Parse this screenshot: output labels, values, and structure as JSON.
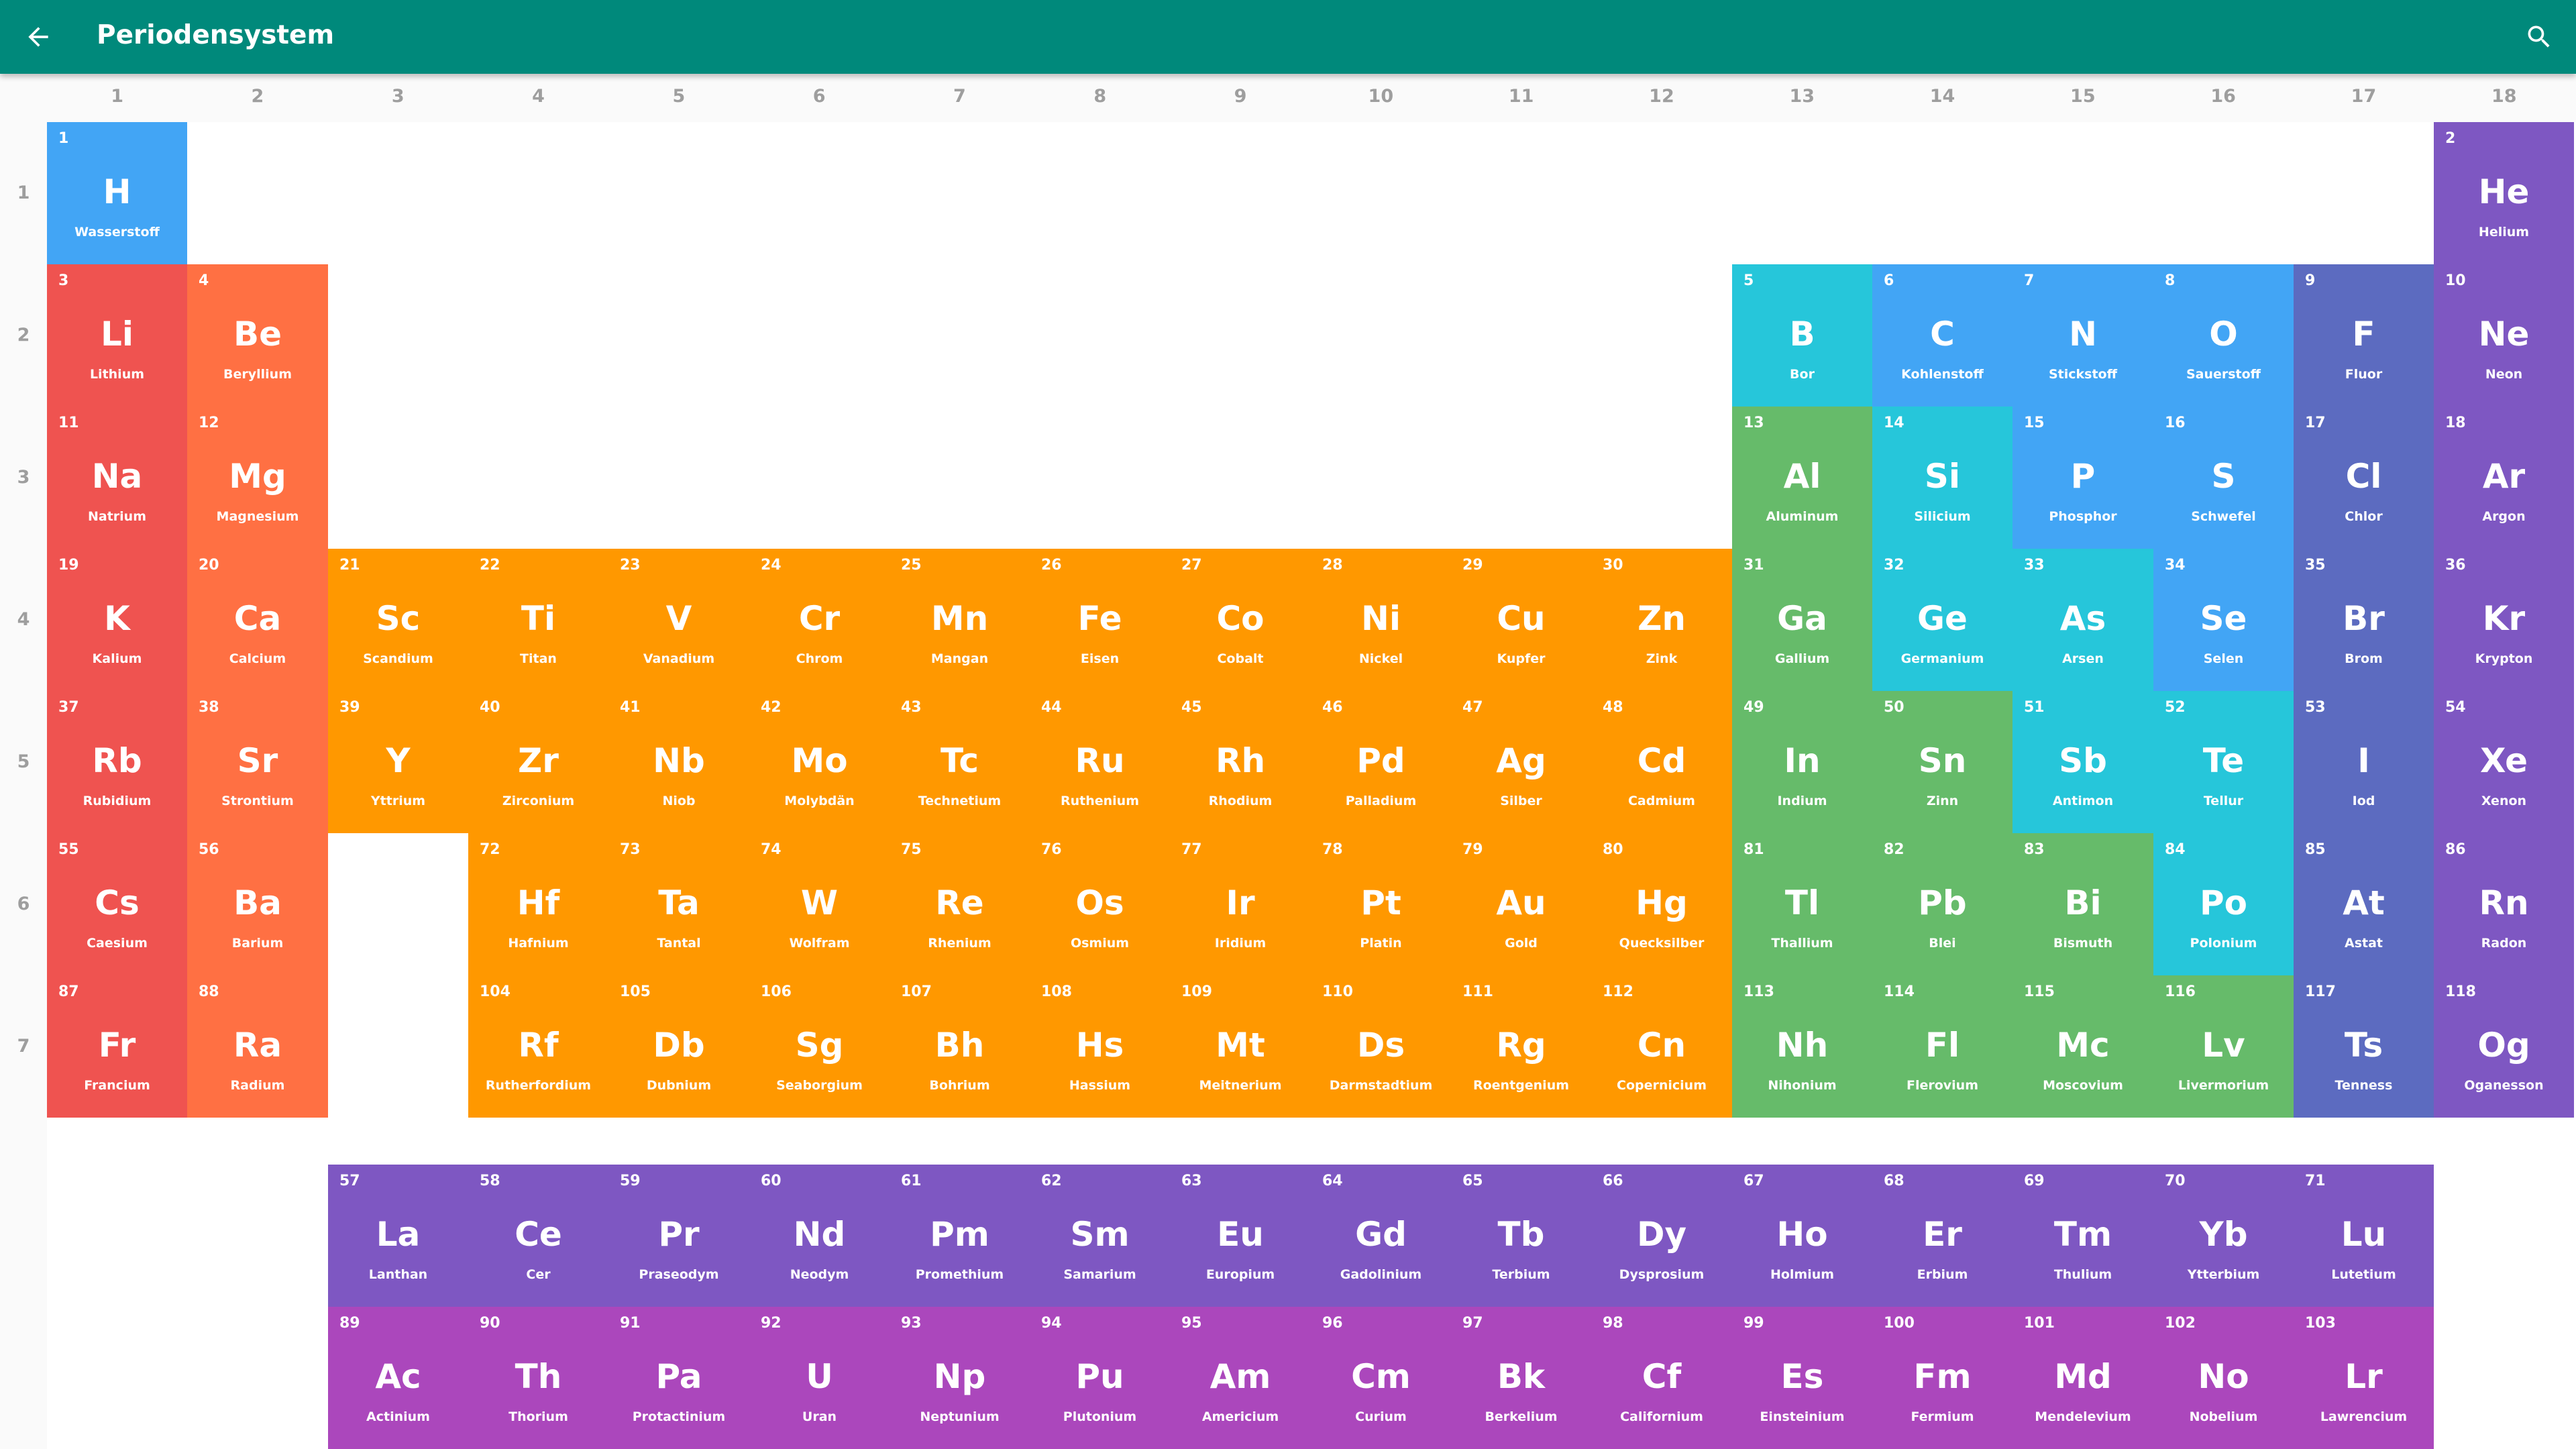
{
  "app_bar": {
    "title": "Periodensystem",
    "background": "#00897b",
    "back_icon": "arrow-back-icon",
    "search_icon": "search-icon"
  },
  "group_numbers": [
    "1",
    "2",
    "3",
    "4",
    "5",
    "6",
    "7",
    "8",
    "9",
    "10",
    "11",
    "12",
    "13",
    "14",
    "15",
    "16",
    "17",
    "18"
  ],
  "period_numbers": [
    "1",
    "2",
    "3",
    "4",
    "5",
    "6",
    "7"
  ],
  "category_colors": {
    "alkali": "#ef5350",
    "alkaline": "#ff7043",
    "transition": "#ff9800",
    "post_transition": "#66bb6a",
    "metalloid": "#26c6da",
    "nonmetal": "#42a5f5",
    "halogen": "#5c6bc0",
    "noble": "#7e57c2",
    "lanthanide": "#7e57c2",
    "actinide": "#ab47bc"
  },
  "elements": [
    {
      "n": "1",
      "s": "H",
      "name": "Wasserstoff",
      "c": "nonmetal",
      "row": 1,
      "col": 1
    },
    {
      "n": "2",
      "s": "He",
      "name": "Helium",
      "c": "noble",
      "row": 1,
      "col": 18
    },
    {
      "n": "3",
      "s": "Li",
      "name": "Lithium",
      "c": "alkali",
      "row": 2,
      "col": 1
    },
    {
      "n": "4",
      "s": "Be",
      "name": "Beryllium",
      "c": "alkaline",
      "row": 2,
      "col": 2
    },
    {
      "n": "5",
      "s": "B",
      "name": "Bor",
      "c": "metalloid",
      "row": 2,
      "col": 13
    },
    {
      "n": "6",
      "s": "C",
      "name": "Kohlenstoff",
      "c": "nonmetal",
      "row": 2,
      "col": 14
    },
    {
      "n": "7",
      "s": "N",
      "name": "Stickstoff",
      "c": "nonmetal",
      "row": 2,
      "col": 15
    },
    {
      "n": "8",
      "s": "O",
      "name": "Sauerstoff",
      "c": "nonmetal",
      "row": 2,
      "col": 16
    },
    {
      "n": "9",
      "s": "F",
      "name": "Fluor",
      "c": "halogen",
      "row": 2,
      "col": 17
    },
    {
      "n": "10",
      "s": "Ne",
      "name": "Neon",
      "c": "noble",
      "row": 2,
      "col": 18
    },
    {
      "n": "11",
      "s": "Na",
      "name": "Natrium",
      "c": "alkali",
      "row": 3,
      "col": 1
    },
    {
      "n": "12",
      "s": "Mg",
      "name": "Magnesium",
      "c": "alkaline",
      "row": 3,
      "col": 2
    },
    {
      "n": "13",
      "s": "Al",
      "name": "Aluminum",
      "c": "post_transition",
      "row": 3,
      "col": 13
    },
    {
      "n": "14",
      "s": "Si",
      "name": "Silicium",
      "c": "metalloid",
      "row": 3,
      "col": 14
    },
    {
      "n": "15",
      "s": "P",
      "name": "Phosphor",
      "c": "nonmetal",
      "row": 3,
      "col": 15
    },
    {
      "n": "16",
      "s": "S",
      "name": "Schwefel",
      "c": "nonmetal",
      "row": 3,
      "col": 16
    },
    {
      "n": "17",
      "s": "Cl",
      "name": "Chlor",
      "c": "halogen",
      "row": 3,
      "col": 17
    },
    {
      "n": "18",
      "s": "Ar",
      "name": "Argon",
      "c": "noble",
      "row": 3,
      "col": 18
    },
    {
      "n": "19",
      "s": "K",
      "name": "Kalium",
      "c": "alkali",
      "row": 4,
      "col": 1
    },
    {
      "n": "20",
      "s": "Ca",
      "name": "Calcium",
      "c": "alkaline",
      "row": 4,
      "col": 2
    },
    {
      "n": "21",
      "s": "Sc",
      "name": "Scandium",
      "c": "transition",
      "row": 4,
      "col": 3
    },
    {
      "n": "22",
      "s": "Ti",
      "name": "Titan",
      "c": "transition",
      "row": 4,
      "col": 4
    },
    {
      "n": "23",
      "s": "V",
      "name": "Vanadium",
      "c": "transition",
      "row": 4,
      "col": 5
    },
    {
      "n": "24",
      "s": "Cr",
      "name": "Chrom",
      "c": "transition",
      "row": 4,
      "col": 6
    },
    {
      "n": "25",
      "s": "Mn",
      "name": "Mangan",
      "c": "transition",
      "row": 4,
      "col": 7
    },
    {
      "n": "26",
      "s": "Fe",
      "name": "Eisen",
      "c": "transition",
      "row": 4,
      "col": 8
    },
    {
      "n": "27",
      "s": "Co",
      "name": "Cobalt",
      "c": "transition",
      "row": 4,
      "col": 9
    },
    {
      "n": "28",
      "s": "Ni",
      "name": "Nickel",
      "c": "transition",
      "row": 4,
      "col": 10
    },
    {
      "n": "29",
      "s": "Cu",
      "name": "Kupfer",
      "c": "transition",
      "row": 4,
      "col": 11
    },
    {
      "n": "30",
      "s": "Zn",
      "name": "Zink",
      "c": "transition",
      "row": 4,
      "col": 12
    },
    {
      "n": "31",
      "s": "Ga",
      "name": "Gallium",
      "c": "post_transition",
      "row": 4,
      "col": 13
    },
    {
      "n": "32",
      "s": "Ge",
      "name": "Germanium",
      "c": "metalloid",
      "row": 4,
      "col": 14
    },
    {
      "n": "33",
      "s": "As",
      "name": "Arsen",
      "c": "metalloid",
      "row": 4,
      "col": 15
    },
    {
      "n": "34",
      "s": "Se",
      "name": "Selen",
      "c": "nonmetal",
      "row": 4,
      "col": 16
    },
    {
      "n": "35",
      "s": "Br",
      "name": "Brom",
      "c": "halogen",
      "row": 4,
      "col": 17
    },
    {
      "n": "36",
      "s": "Kr",
      "name": "Krypton",
      "c": "noble",
      "row": 4,
      "col": 18
    },
    {
      "n": "37",
      "s": "Rb",
      "name": "Rubidium",
      "c": "alkali",
      "row": 5,
      "col": 1
    },
    {
      "n": "38",
      "s": "Sr",
      "name": "Strontium",
      "c": "alkaline",
      "row": 5,
      "col": 2
    },
    {
      "n": "39",
      "s": "Y",
      "name": "Yttrium",
      "c": "transition",
      "row": 5,
      "col": 3
    },
    {
      "n": "40",
      "s": "Zr",
      "name": "Zirconium",
      "c": "transition",
      "row": 5,
      "col": 4
    },
    {
      "n": "41",
      "s": "Nb",
      "name": "Niob",
      "c": "transition",
      "row": 5,
      "col": 5
    },
    {
      "n": "42",
      "s": "Mo",
      "name": "Molybdän",
      "c": "transition",
      "row": 5,
      "col": 6
    },
    {
      "n": "43",
      "s": "Tc",
      "name": "Technetium",
      "c": "transition",
      "row": 5,
      "col": 7
    },
    {
      "n": "44",
      "s": "Ru",
      "name": "Ruthenium",
      "c": "transition",
      "row": 5,
      "col": 8
    },
    {
      "n": "45",
      "s": "Rh",
      "name": "Rhodium",
      "c": "transition",
      "row": 5,
      "col": 9
    },
    {
      "n": "46",
      "s": "Pd",
      "name": "Palladium",
      "c": "transition",
      "row": 5,
      "col": 10
    },
    {
      "n": "47",
      "s": "Ag",
      "name": "Silber",
      "c": "transition",
      "row": 5,
      "col": 11
    },
    {
      "n": "48",
      "s": "Cd",
      "name": "Cadmium",
      "c": "transition",
      "row": 5,
      "col": 12
    },
    {
      "n": "49",
      "s": "In",
      "name": "Indium",
      "c": "post_transition",
      "row": 5,
      "col": 13
    },
    {
      "n": "50",
      "s": "Sn",
      "name": "Zinn",
      "c": "post_transition",
      "row": 5,
      "col": 14
    },
    {
      "n": "51",
      "s": "Sb",
      "name": "Antimon",
      "c": "metalloid",
      "row": 5,
      "col": 15
    },
    {
      "n": "52",
      "s": "Te",
      "name": "Tellur",
      "c": "metalloid",
      "row": 5,
      "col": 16
    },
    {
      "n": "53",
      "s": "I",
      "name": "Iod",
      "c": "halogen",
      "row": 5,
      "col": 17
    },
    {
      "n": "54",
      "s": "Xe",
      "name": "Xenon",
      "c": "noble",
      "row": 5,
      "col": 18
    },
    {
      "n": "55",
      "s": "Cs",
      "name": "Caesium",
      "c": "alkali",
      "row": 6,
      "col": 1
    },
    {
      "n": "56",
      "s": "Ba",
      "name": "Barium",
      "c": "alkaline",
      "row": 6,
      "col": 2
    },
    {
      "n": "72",
      "s": "Hf",
      "name": "Hafnium",
      "c": "transition",
      "row": 6,
      "col": 4
    },
    {
      "n": "73",
      "s": "Ta",
      "name": "Tantal",
      "c": "transition",
      "row": 6,
      "col": 5
    },
    {
      "n": "74",
      "s": "W",
      "name": "Wolfram",
      "c": "transition",
      "row": 6,
      "col": 6
    },
    {
      "n": "75",
      "s": "Re",
      "name": "Rhenium",
      "c": "transition",
      "row": 6,
      "col": 7
    },
    {
      "n": "76",
      "s": "Os",
      "name": "Osmium",
      "c": "transition",
      "row": 6,
      "col": 8
    },
    {
      "n": "77",
      "s": "Ir",
      "name": "Iridium",
      "c": "transition",
      "row": 6,
      "col": 9
    },
    {
      "n": "78",
      "s": "Pt",
      "name": "Platin",
      "c": "transition",
      "row": 6,
      "col": 10
    },
    {
      "n": "79",
      "s": "Au",
      "name": "Gold",
      "c": "transition",
      "row": 6,
      "col": 11
    },
    {
      "n": "80",
      "s": "Hg",
      "name": "Quecksilber",
      "c": "transition",
      "row": 6,
      "col": 12
    },
    {
      "n": "81",
      "s": "Tl",
      "name": "Thallium",
      "c": "post_transition",
      "row": 6,
      "col": 13
    },
    {
      "n": "82",
      "s": "Pb",
      "name": "Blei",
      "c": "post_transition",
      "row": 6,
      "col": 14
    },
    {
      "n": "83",
      "s": "Bi",
      "name": "Bismuth",
      "c": "post_transition",
      "row": 6,
      "col": 15
    },
    {
      "n": "84",
      "s": "Po",
      "name": "Polonium",
      "c": "metalloid",
      "row": 6,
      "col": 16
    },
    {
      "n": "85",
      "s": "At",
      "name": "Astat",
      "c": "halogen",
      "row": 6,
      "col": 17
    },
    {
      "n": "86",
      "s": "Rn",
      "name": "Radon",
      "c": "noble",
      "row": 6,
      "col": 18
    },
    {
      "n": "87",
      "s": "Fr",
      "name": "Francium",
      "c": "alkali",
      "row": 7,
      "col": 1
    },
    {
      "n": "88",
      "s": "Ra",
      "name": "Radium",
      "c": "alkaline",
      "row": 7,
      "col": 2
    },
    {
      "n": "104",
      "s": "Rf",
      "name": "Rutherfordium",
      "c": "transition",
      "row": 7,
      "col": 4
    },
    {
      "n": "105",
      "s": "Db",
      "name": "Dubnium",
      "c": "transition",
      "row": 7,
      "col": 5
    },
    {
      "n": "106",
      "s": "Sg",
      "name": "Seaborgium",
      "c": "transition",
      "row": 7,
      "col": 6
    },
    {
      "n": "107",
      "s": "Bh",
      "name": "Bohrium",
      "c": "transition",
      "row": 7,
      "col": 7
    },
    {
      "n": "108",
      "s": "Hs",
      "name": "Hassium",
      "c": "transition",
      "row": 7,
      "col": 8
    },
    {
      "n": "109",
      "s": "Mt",
      "name": "Meitnerium",
      "c": "transition",
      "row": 7,
      "col": 9
    },
    {
      "n": "110",
      "s": "Ds",
      "name": "Darmstadtium",
      "c": "transition",
      "row": 7,
      "col": 10
    },
    {
      "n": "111",
      "s": "Rg",
      "name": "Roentgenium",
      "c": "transition",
      "row": 7,
      "col": 11
    },
    {
      "n": "112",
      "s": "Cn",
      "name": "Copernicium",
      "c": "transition",
      "row": 7,
      "col": 12
    },
    {
      "n": "113",
      "s": "Nh",
      "name": "Nihonium",
      "c": "post_transition",
      "row": 7,
      "col": 13
    },
    {
      "n": "114",
      "s": "Fl",
      "name": "Flerovium",
      "c": "post_transition",
      "row": 7,
      "col": 14
    },
    {
      "n": "115",
      "s": "Mc",
      "name": "Moscovium",
      "c": "post_transition",
      "row": 7,
      "col": 15
    },
    {
      "n": "116",
      "s": "Lv",
      "name": "Livermorium",
      "c": "post_transition",
      "row": 7,
      "col": 16
    },
    {
      "n": "117",
      "s": "Ts",
      "name": "Tenness",
      "c": "halogen",
      "row": 7,
      "col": 17
    },
    {
      "n": "118",
      "s": "Og",
      "name": "Oganesson",
      "c": "noble",
      "row": 7,
      "col": 18
    },
    {
      "n": "57",
      "s": "La",
      "name": "Lanthan",
      "c": "lanthanide",
      "row": 8,
      "col": 3
    },
    {
      "n": "58",
      "s": "Ce",
      "name": "Cer",
      "c": "lanthanide",
      "row": 8,
      "col": 4
    },
    {
      "n": "59",
      "s": "Pr",
      "name": "Praseodym",
      "c": "lanthanide",
      "row": 8,
      "col": 5
    },
    {
      "n": "60",
      "s": "Nd",
      "name": "Neodym",
      "c": "lanthanide",
      "row": 8,
      "col": 6
    },
    {
      "n": "61",
      "s": "Pm",
      "name": "Promethium",
      "c": "lanthanide",
      "row": 8,
      "col": 7
    },
    {
      "n": "62",
      "s": "Sm",
      "name": "Samarium",
      "c": "lanthanide",
      "row": 8,
      "col": 8
    },
    {
      "n": "63",
      "s": "Eu",
      "name": "Europium",
      "c": "lanthanide",
      "row": 8,
      "col": 9
    },
    {
      "n": "64",
      "s": "Gd",
      "name": "Gadolinium",
      "c": "lanthanide",
      "row": 8,
      "col": 10
    },
    {
      "n": "65",
      "s": "Tb",
      "name": "Terbium",
      "c": "lanthanide",
      "row": 8,
      "col": 11
    },
    {
      "n": "66",
      "s": "Dy",
      "name": "Dysprosium",
      "c": "lanthanide",
      "row": 8,
      "col": 12
    },
    {
      "n": "67",
      "s": "Ho",
      "name": "Holmium",
      "c": "lanthanide",
      "row": 8,
      "col": 13
    },
    {
      "n": "68",
      "s": "Er",
      "name": "Erbium",
      "c": "lanthanide",
      "row": 8,
      "col": 14
    },
    {
      "n": "69",
      "s": "Tm",
      "name": "Thulium",
      "c": "lanthanide",
      "row": 8,
      "col": 15
    },
    {
      "n": "70",
      "s": "Yb",
      "name": "Ytterbium",
      "c": "lanthanide",
      "row": 8,
      "col": 16
    },
    {
      "n": "71",
      "s": "Lu",
      "name": "Lutetium",
      "c": "lanthanide",
      "row": 8,
      "col": 17
    },
    {
      "n": "89",
      "s": "Ac",
      "name": "Actinium",
      "c": "actinide",
      "row": 9,
      "col": 3
    },
    {
      "n": "90",
      "s": "Th",
      "name": "Thorium",
      "c": "actinide",
      "row": 9,
      "col": 4
    },
    {
      "n": "91",
      "s": "Pa",
      "name": "Protactinium",
      "c": "actinide",
      "row": 9,
      "col": 5
    },
    {
      "n": "92",
      "s": "U",
      "name": "Uran",
      "c": "actinide",
      "row": 9,
      "col": 6
    },
    {
      "n": "93",
      "s": "Np",
      "name": "Neptunium",
      "c": "actinide",
      "row": 9,
      "col": 7
    },
    {
      "n": "94",
      "s": "Pu",
      "name": "Plutonium",
      "c": "actinide",
      "row": 9,
      "col": 8
    },
    {
      "n": "95",
      "s": "Am",
      "name": "Americium",
      "c": "actinide",
      "row": 9,
      "col": 9
    },
    {
      "n": "96",
      "s": "Cm",
      "name": "Curium",
      "c": "actinide",
      "row": 9,
      "col": 10
    },
    {
      "n": "97",
      "s": "Bk",
      "name": "Berkelium",
      "c": "actinide",
      "row": 9,
      "col": 11
    },
    {
      "n": "98",
      "s": "Cf",
      "name": "Californium",
      "c": "actinide",
      "row": 9,
      "col": 12
    },
    {
      "n": "99",
      "s": "Es",
      "name": "Einsteinium",
      "c": "actinide",
      "row": 9,
      "col": 13
    },
    {
      "n": "100",
      "s": "Fm",
      "name": "Fermium",
      "c": "actinide",
      "row": 9,
      "col": 14
    },
    {
      "n": "101",
      "s": "Md",
      "name": "Mendelevium",
      "c": "actinide",
      "row": 9,
      "col": 15
    },
    {
      "n": "102",
      "s": "No",
      "name": "Nobelium",
      "c": "actinide",
      "row": 9,
      "col": 16
    },
    {
      "n": "103",
      "s": "Lr",
      "name": "Lawrencium",
      "c": "actinide",
      "row": 9,
      "col": 17
    }
  ]
}
